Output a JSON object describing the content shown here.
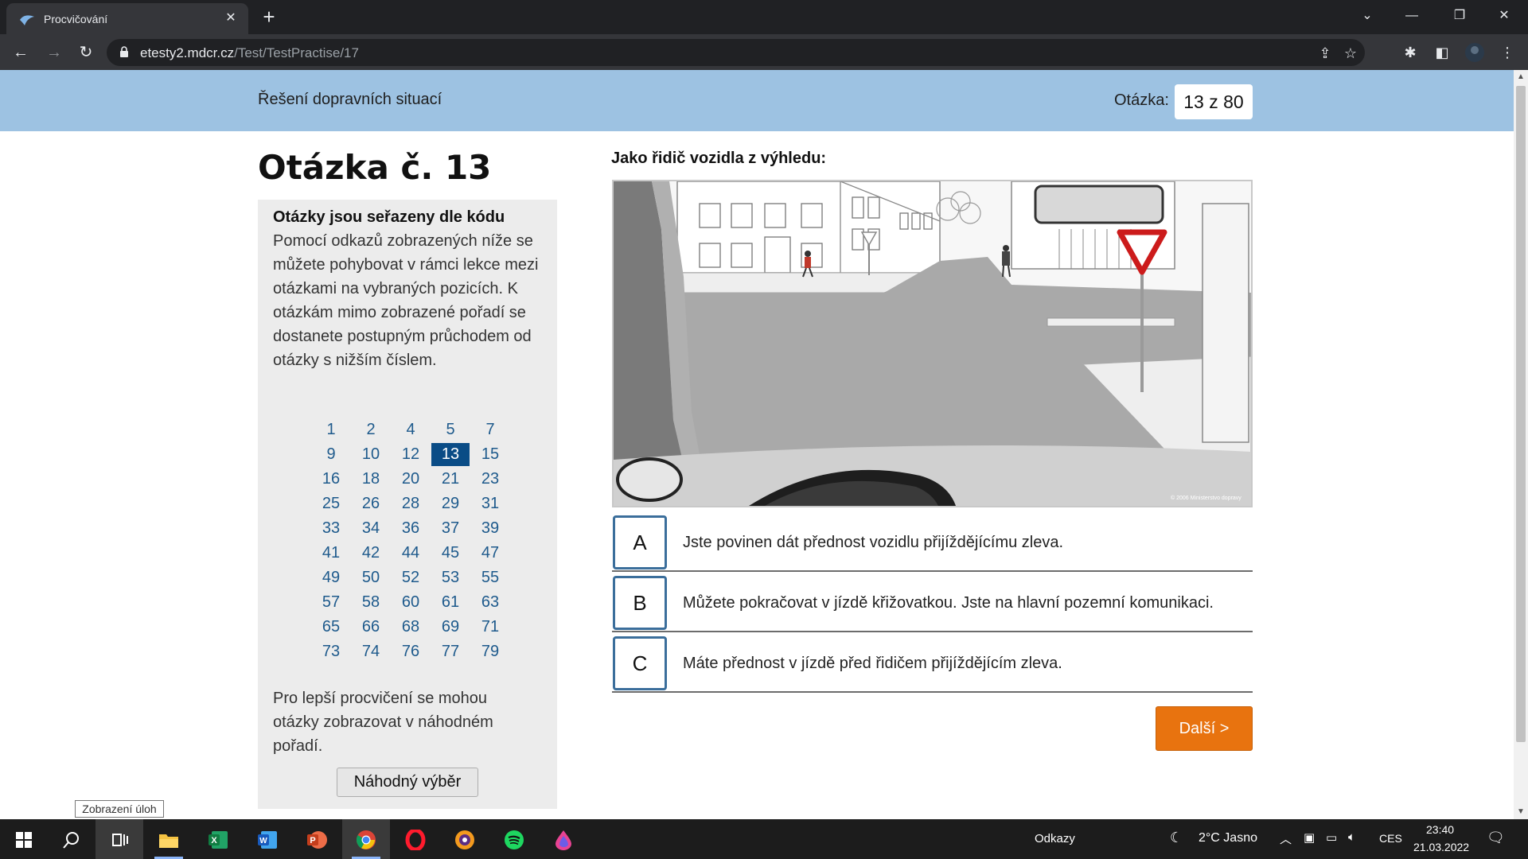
{
  "browser": {
    "tab_title": "Procvičování",
    "url_host": "etesty2.mdcr.cz",
    "url_path": "/Test/TestPractise/17"
  },
  "header": {
    "topic": "Řešení dopravních situací",
    "question_label": "Otázka:",
    "question_counter": "13 z 80"
  },
  "question": {
    "title": "Otázka č. 13",
    "prompt": "Jako řidič vozidla z výhledu:",
    "answers": [
      {
        "letter": "A",
        "text": "Jste povinen dát přednost vozidlu přijíždějícímu zleva."
      },
      {
        "letter": "B",
        "text": "Můžete pokračovat v jízdě křižovatkou. Jste na hlavní pozemní komunikaci."
      },
      {
        "letter": "C",
        "text": "Máte přednost v jízdě před řidičem přijíždějícím zleva."
      }
    ],
    "next_label": "Další >",
    "image_copyright": "© 2006 Ministerstvo dopravy"
  },
  "sidebar": {
    "heading": "Otázky jsou seřazeny dle kódu",
    "description": "Pomocí odkazů zobrazených níže se můžete pohybovat v rámci lekce mezi otázkami na vybraných pozicích. K otázkám mimo zobrazené pořadí se dostanete postupným průchodem od otázky s nižším číslem.",
    "numbers": [
      "1",
      "2",
      "4",
      "5",
      "7",
      "9",
      "10",
      "12",
      "13",
      "15",
      "16",
      "18",
      "20",
      "21",
      "23",
      "25",
      "26",
      "28",
      "29",
      "31",
      "33",
      "34",
      "36",
      "37",
      "39",
      "41",
      "42",
      "44",
      "45",
      "47",
      "49",
      "50",
      "52",
      "53",
      "55",
      "57",
      "58",
      "60",
      "61",
      "63",
      "65",
      "66",
      "68",
      "69",
      "71",
      "73",
      "74",
      "76",
      "77",
      "79"
    ],
    "active_number": "13",
    "note": "Pro lepší procvičení se mohou otázky zobrazovat v náhodném pořadí.",
    "random_button": "Náhodný výběr"
  },
  "tooltip": "Zobrazení úloh",
  "taskbar": {
    "links_label": "Odkazy",
    "weather": "2°C  Jasno",
    "language": "CES",
    "time": "23:40",
    "date": "21.03.2022"
  },
  "colors": {
    "header_band": "#9dc2e2",
    "active_number": "#0a4c86",
    "link_number": "#1e5a8c",
    "next_button": "#e8730f",
    "answer_border": "#3b6e9b"
  }
}
